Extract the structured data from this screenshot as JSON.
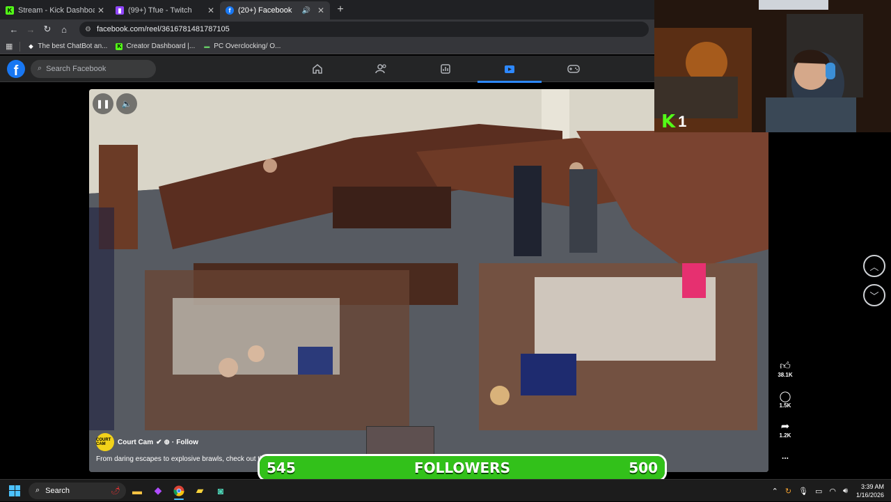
{
  "browser": {
    "tabs": [
      {
        "title": "Stream - Kick Dashboard",
        "favicon": "kick-icon",
        "active": false
      },
      {
        "title": "(99+) Tfue - Twitch",
        "favicon": "twitch-icon",
        "active": false
      },
      {
        "title": "(20+) Facebook",
        "favicon": "facebook-icon",
        "active": true
      }
    ],
    "url": "facebook.com/reel/3616781481787105",
    "bookmarks": [
      {
        "label": "The best ChatBot an...",
        "icon": "chatbot-icon"
      },
      {
        "label": "Creator Dashboard |...",
        "icon": "kick-icon"
      },
      {
        "label": "PC Overclocking/ O...",
        "icon": "pc-icon"
      }
    ]
  },
  "facebook": {
    "search_placeholder": "Search Facebook",
    "nav": [
      "home-icon",
      "friends-icon",
      "dashboard-icon",
      "video-icon",
      "gaming-icon"
    ],
    "active_nav": "video-icon"
  },
  "reel": {
    "author": "Court Cam",
    "avatar_text": "COURT CAM",
    "follow": "Follow",
    "description": "From daring escapes to explosive brawls, check out th",
    "likes": "38.1K",
    "comments": "1.5K",
    "shares": "1.2K",
    "more": "..."
  },
  "overlay": {
    "kick_viewers": "1",
    "goal_current": "545",
    "goal_label": "FOLLOWERS",
    "goal_target": "500",
    "goal_progress": 1.0,
    "goal_color": "#32c11a"
  },
  "taskbar": {
    "search": "Search",
    "time": "3:39 AM",
    "date": "1/16/2026"
  }
}
